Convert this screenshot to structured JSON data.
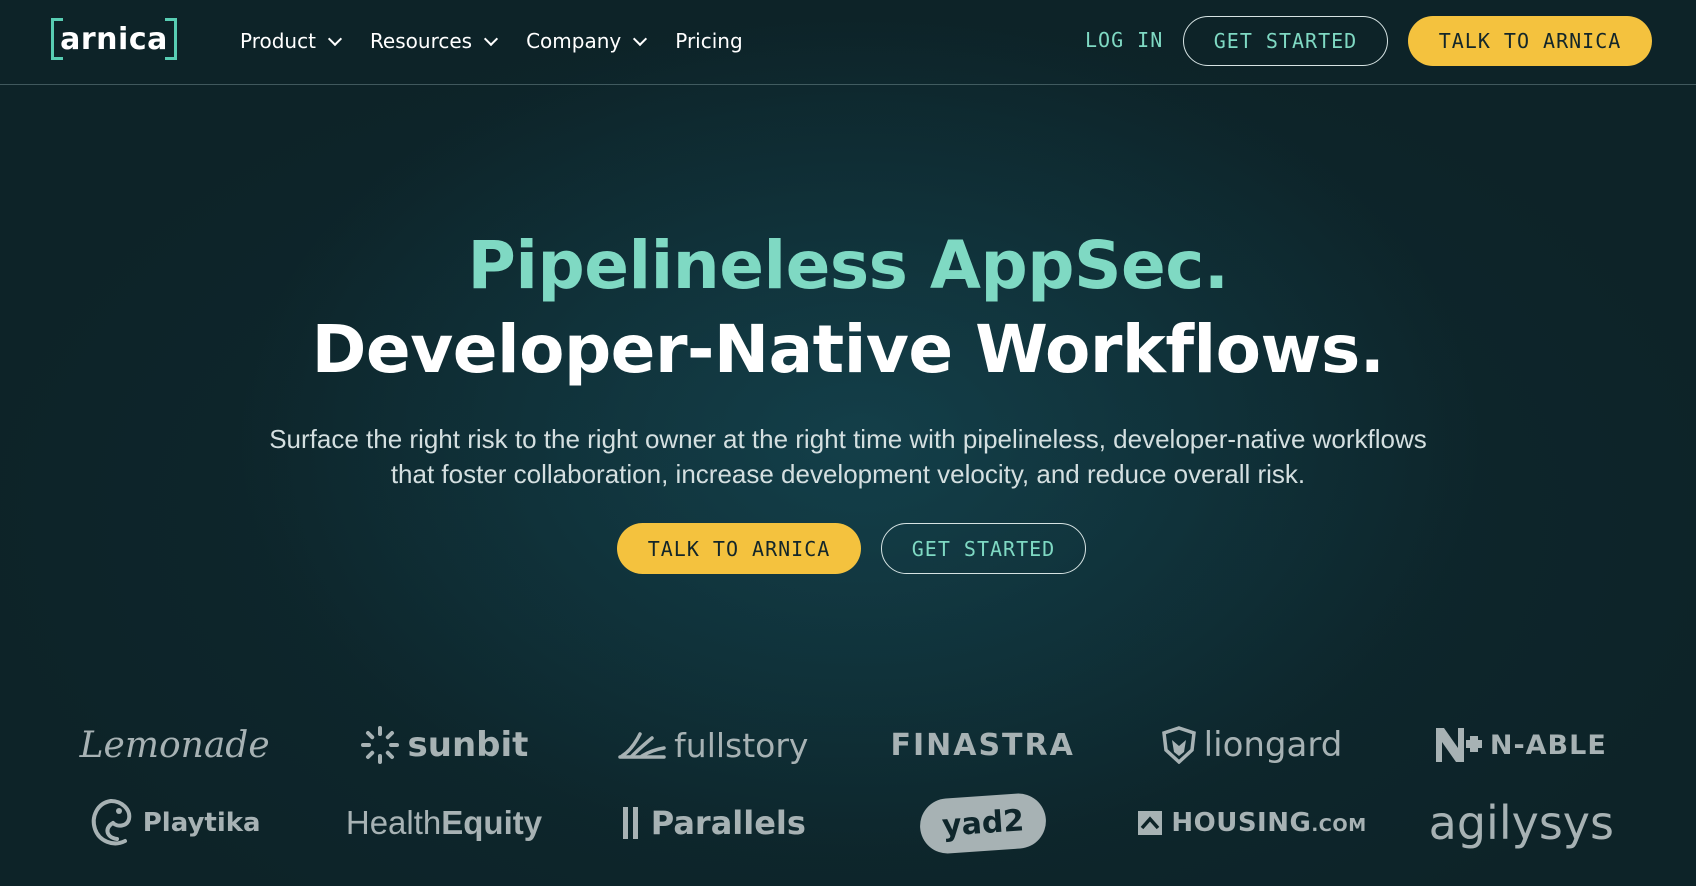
{
  "nav": {
    "logo_text": "arnica",
    "menu": [
      {
        "label": "Product",
        "has_dropdown": true
      },
      {
        "label": "Resources",
        "has_dropdown": true
      },
      {
        "label": "Company",
        "has_dropdown": true
      },
      {
        "label": "Pricing",
        "has_dropdown": false
      }
    ],
    "login_label": "LOG IN",
    "get_started_label": "GET STARTED",
    "talk_label": "TALK TO ARNICA"
  },
  "hero": {
    "title_line1": "Pipelineless AppSec.",
    "title_line2": "Developer-Native Workflows.",
    "subtitle": "Surface the right risk to the right owner at the right time with pipelineless, developer-native workflows that foster collaboration, increase development velocity, and reduce overall risk.",
    "primary_cta": "TALK TO ARNICA",
    "secondary_cta": "GET STARTED"
  },
  "customer_logos": {
    "row1": [
      "Lemonade",
      "sunbit",
      "fullstory",
      "FINASTRA",
      "liongard",
      "N-ABLE"
    ],
    "row2": [
      "Playtika",
      "Health",
      "Equity",
      "Parallels",
      "yad2",
      "HOUSING",
      ".COM",
      "agilysys"
    ]
  },
  "colors": {
    "background": "#0d2328",
    "accent_teal": "#7fd9c3",
    "logo_bracket": "#58cdb3",
    "cta_yellow": "#f4c23e",
    "logo_gray": "#a7b2b4"
  },
  "icons": [
    "chevron-down-icon",
    "sunbit-icon",
    "fullstory-icon",
    "liongard-icon",
    "n-able-icon",
    "playtika-icon",
    "parallels-icon",
    "housing-icon"
  ]
}
